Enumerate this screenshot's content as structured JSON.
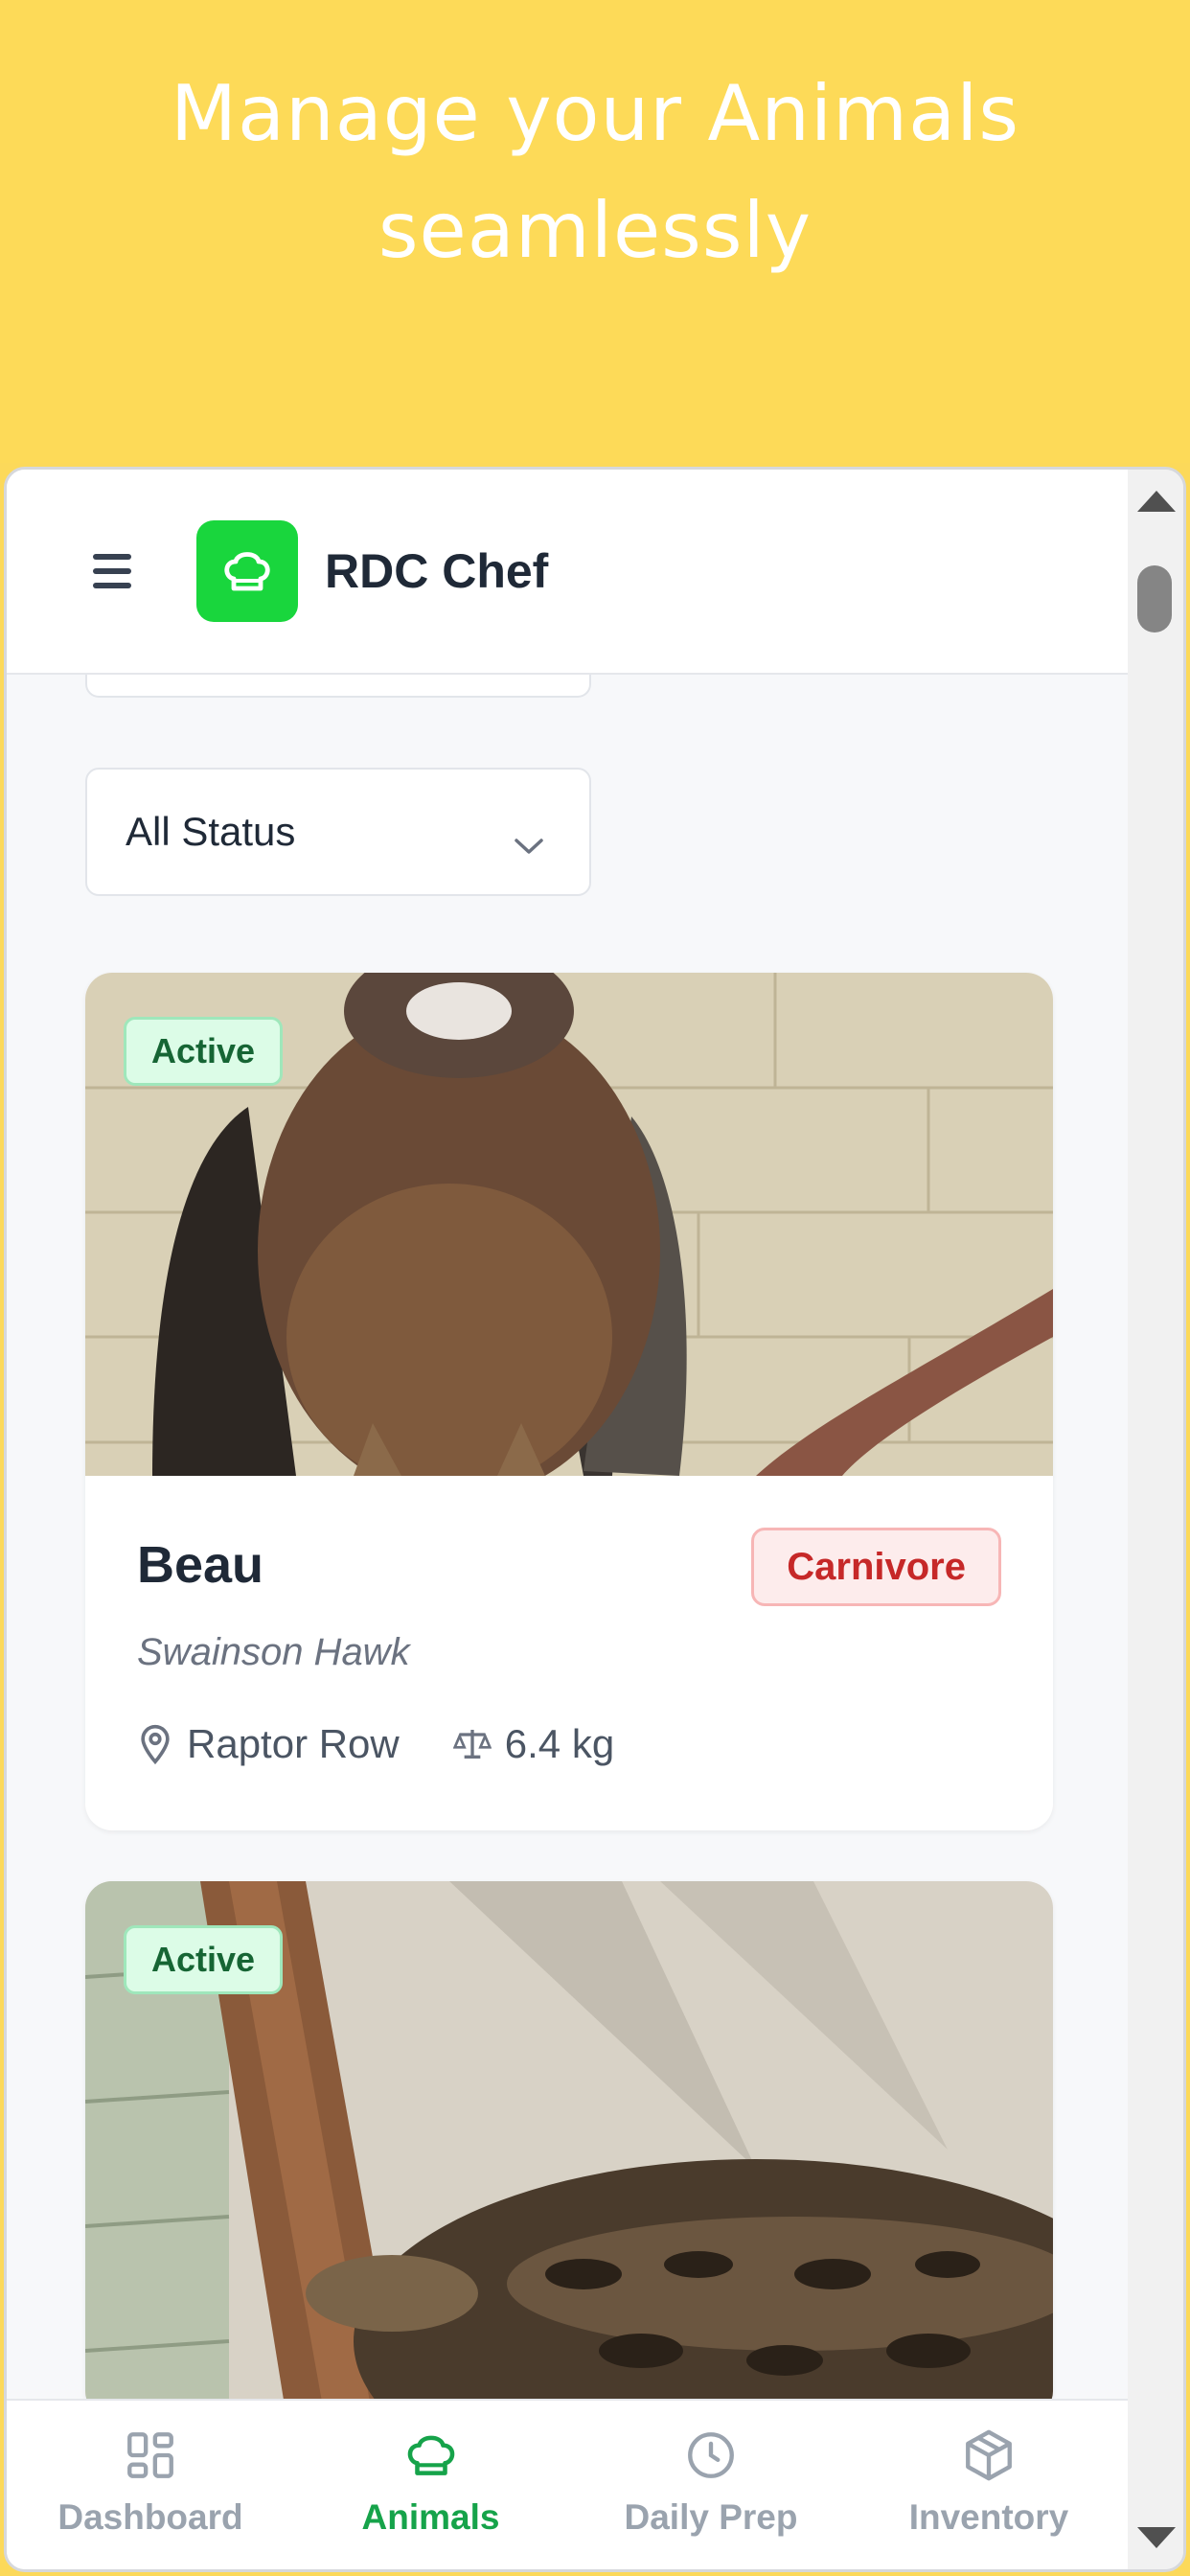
{
  "promo": {
    "title": "Manage your Animals seamlessly"
  },
  "header": {
    "app_name": "RDC Chef"
  },
  "filter": {
    "status_selected": "All Status"
  },
  "animals": [
    {
      "status": "Active",
      "name": "Beau",
      "species": "Swainson Hawk",
      "diet": "Carnivore",
      "location": "Raptor Row",
      "weight": "6.4 kg"
    },
    {
      "status": "Active"
    }
  ],
  "nav": {
    "items": [
      {
        "label": "Dashboard",
        "icon": "grid-icon"
      },
      {
        "label": "Animals",
        "icon": "chef-hat-icon",
        "active": true
      },
      {
        "label": "Daily Prep",
        "icon": "clock-icon"
      },
      {
        "label": "Inventory",
        "icon": "box-icon"
      }
    ]
  },
  "colors": {
    "promo_bg": "#fdda58",
    "brand_green": "#19d63d",
    "active_nav": "#16a34a",
    "diet_red": "#c62828"
  }
}
